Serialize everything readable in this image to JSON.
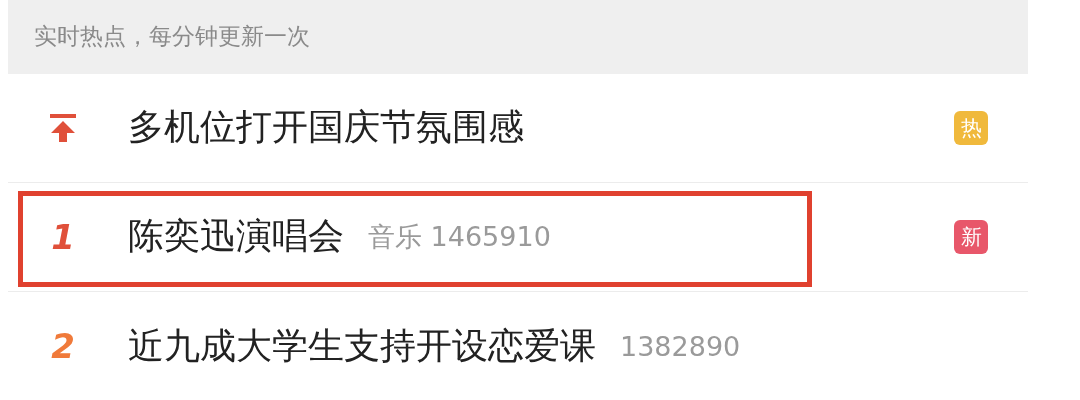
{
  "header": {
    "text": "实时热点，每分钟更新一次"
  },
  "rows": [
    {
      "kind": "pinned",
      "rank": "",
      "title": "多机位打开国庆节氛围感",
      "meta": "",
      "badge": "热",
      "color": "#f0b93c",
      "highlighted": false
    },
    {
      "kind": "ranked",
      "rank": "1",
      "title": "陈奕迅演唱会",
      "meta": "音乐 1465910",
      "badge": "新",
      "color": "#e8576a",
      "highlighted": true
    },
    {
      "kind": "ranked",
      "rank": "2",
      "title": "近九成大学生支持开设恋爱课",
      "meta": "1382890",
      "badge": "",
      "highlighted": false
    }
  ]
}
